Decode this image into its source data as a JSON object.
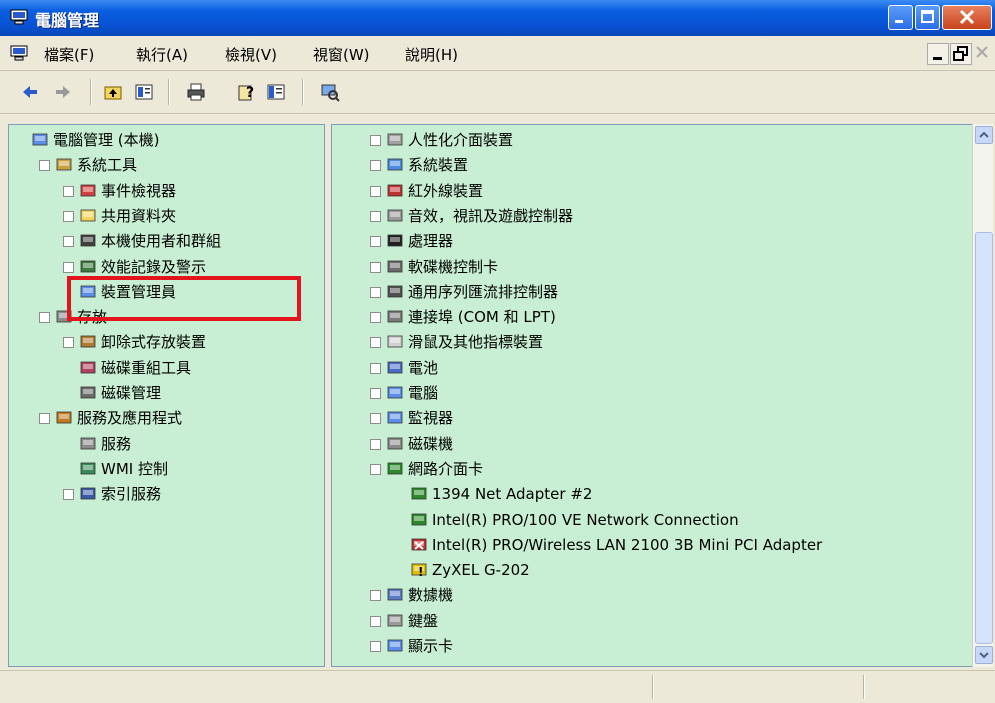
{
  "window": {
    "title": "電腦管理"
  },
  "menu": [
    "檔案(F)",
    "執行(A)",
    "檢視(V)",
    "視窗(W)",
    "說明(H)"
  ],
  "toolbar": {
    "back": "back-arrow-icon",
    "forward": "forward-arrow-icon",
    "up": "up-folder-icon",
    "properties": "properties-icon",
    "print": "printer-icon",
    "help": "help-icon",
    "view": "view-pane-icon",
    "scan": "scan-hardware-icon"
  },
  "left_tree": [
    {
      "label": "電腦管理 (本機)",
      "expander": "",
      "icon": "computer-icon"
    },
    {
      "label": "系統工具",
      "expander": "−",
      "icon": "tools-icon"
    },
    {
      "label": "事件檢視器",
      "expander": "+",
      "icon": "event-viewer-icon"
    },
    {
      "label": "共用資料夾",
      "expander": "+",
      "icon": "folder-icon"
    },
    {
      "label": "本機使用者和群組",
      "expander": "+",
      "icon": "users-icon"
    },
    {
      "label": "效能記錄及警示",
      "expander": "+",
      "icon": "performance-icon"
    },
    {
      "label": "裝置管理員",
      "expander": "",
      "icon": "device-manager-icon"
    },
    {
      "label": "存放",
      "expander": "−",
      "icon": "storage-icon"
    },
    {
      "label": "卸除式存放裝置",
      "expander": "+",
      "icon": "removable-storage-icon"
    },
    {
      "label": "磁碟重組工具",
      "expander": "",
      "icon": "defrag-icon"
    },
    {
      "label": "磁碟管理",
      "expander": "",
      "icon": "disk-management-icon"
    },
    {
      "label": "服務及應用程式",
      "expander": "−",
      "icon": "services-apps-icon"
    },
    {
      "label": "服務",
      "expander": "",
      "icon": "services-icon"
    },
    {
      "label": "WMI 控制",
      "expander": "",
      "icon": "wmi-icon"
    },
    {
      "label": "索引服務",
      "expander": "+",
      "icon": "indexing-icon"
    }
  ],
  "right_tree": [
    {
      "label": "人性化介面裝置",
      "expander": "+",
      "icon": "hid-icon"
    },
    {
      "label": "系統裝置",
      "expander": "+",
      "icon": "system-device-icon"
    },
    {
      "label": "紅外線裝置",
      "expander": "+",
      "icon": "infrared-icon"
    },
    {
      "label": "音效，視訊及遊戲控制器",
      "expander": "+",
      "icon": "sound-icon"
    },
    {
      "label": "處理器",
      "expander": "+",
      "icon": "processor-icon"
    },
    {
      "label": "軟碟機控制卡",
      "expander": "+",
      "icon": "floppy-controller-icon"
    },
    {
      "label": "通用序列匯流排控制器",
      "expander": "+",
      "icon": "usb-icon"
    },
    {
      "label": "連接埠 (COM 和 LPT)",
      "expander": "+",
      "icon": "port-icon"
    },
    {
      "label": "滑鼠及其他指標裝置",
      "expander": "+",
      "icon": "mouse-icon"
    },
    {
      "label": "電池",
      "expander": "+",
      "icon": "battery-icon"
    },
    {
      "label": "電腦",
      "expander": "+",
      "icon": "computer-icon"
    },
    {
      "label": "監視器",
      "expander": "+",
      "icon": "monitor-icon"
    },
    {
      "label": "磁碟機",
      "expander": "+",
      "icon": "disk-drive-icon"
    },
    {
      "label": "網路介面卡",
      "expander": "−",
      "icon": "network-adapter-icon"
    },
    {
      "label": "1394 Net Adapter #2",
      "expander": "",
      "icon": "network-adapter-icon"
    },
    {
      "label": "Intel(R) PRO/100 VE Network Connection",
      "expander": "",
      "icon": "network-adapter-icon"
    },
    {
      "label": "Intel(R) PRO/Wireless LAN 2100 3B Mini PCI Adapter",
      "expander": "",
      "icon": "network-adapter-disabled-icon"
    },
    {
      "label": "ZyXEL G-202",
      "expander": "",
      "icon": "network-adapter-warning-icon"
    },
    {
      "label": "數據機",
      "expander": "+",
      "icon": "modem-icon"
    },
    {
      "label": "鍵盤",
      "expander": "+",
      "icon": "keyboard-icon"
    },
    {
      "label": "顯示卡",
      "expander": "+",
      "icon": "display-adapter-icon"
    }
  ],
  "colors": {
    "pane_bg": "#c8efd3",
    "title_bar": "#0a5fe0",
    "highlight_border": "#e4141c"
  }
}
